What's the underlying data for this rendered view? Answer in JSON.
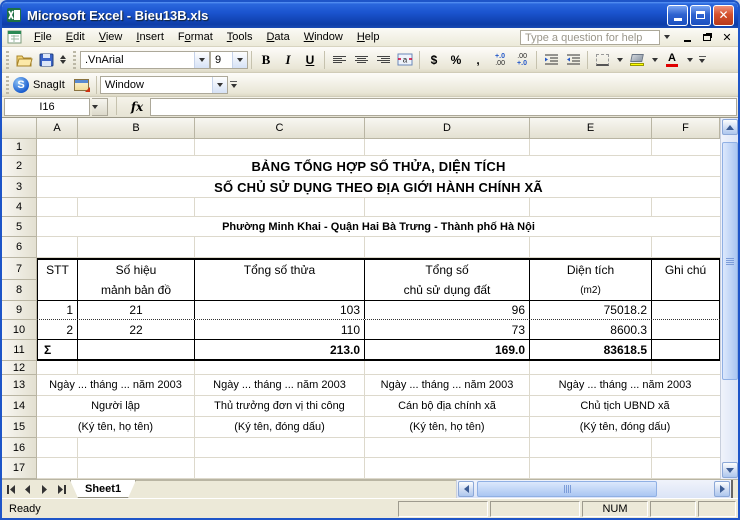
{
  "window": {
    "title": "Microsoft Excel - Bieu13B.xls"
  },
  "menu": {
    "items": [
      {
        "label": "File",
        "u": 0
      },
      {
        "label": "Edit",
        "u": 0
      },
      {
        "label": "View",
        "u": 0
      },
      {
        "label": "Insert",
        "u": 0
      },
      {
        "label": "Format",
        "u": 1
      },
      {
        "label": "Tools",
        "u": 0
      },
      {
        "label": "Data",
        "u": 0
      },
      {
        "label": "Window",
        "u": 0
      },
      {
        "label": "Help",
        "u": 0
      }
    ],
    "help_placeholder": "Type a question for help"
  },
  "toolbar": {
    "font_name": ".VnArial",
    "font_size": "9",
    "bold": "B",
    "italic": "I",
    "underline": "U",
    "currency": "$",
    "percent": "%",
    "comma": ",",
    "inc_decimal_top": "+.0",
    "inc_decimal_bot": ".00",
    "dec_decimal_top": ".00",
    "dec_decimal_bot": "+.0",
    "font_color_letter": "A"
  },
  "snagit": {
    "label": "SnagIt",
    "mode": "Window"
  },
  "formula_bar": {
    "name_box": "I16",
    "fx": "fx"
  },
  "grid": {
    "columns": [
      "A",
      "B",
      "C",
      "D",
      "E",
      "F"
    ],
    "rows": [
      "1",
      "2",
      "3",
      "4",
      "5",
      "6",
      "7",
      "8",
      "9",
      "10",
      "11",
      "12",
      "13",
      "14",
      "15",
      "16",
      "17"
    ]
  },
  "sheet": {
    "title_line1": "BẢNG TỔNG HỢP SỐ THỬA, DIỆN TÍCH",
    "title_line2": "SỐ CHỦ SỬ DỤNG THEO ĐỊA GIỚI HÀNH CHÍNH XÃ",
    "subtitle": "Phường Minh Khai  -  Quận Hai Bà Trưng  -  Thành phố Hà Nội",
    "table": {
      "header": {
        "stt": "STT",
        "map_sheet_1": "Số hiệu",
        "map_sheet_2": "mảnh bản đồ",
        "parcels": "Tổng số thửa",
        "owners_1": "Tổng số",
        "owners_2": "chủ sử dụng đất",
        "area_1": "Diện tích",
        "area_2": "(m2)",
        "notes": "Ghi chú"
      },
      "rows": [
        {
          "stt": "1",
          "map": "21",
          "parcels": "103",
          "owners": "96",
          "area": "75018.2"
        },
        {
          "stt": "2",
          "map": "22",
          "parcels": "110",
          "owners": "73",
          "area": "8600.3"
        }
      ],
      "total": {
        "symbol": "Σ",
        "parcels": "213.0",
        "owners": "169.0",
        "area": "83618.5"
      }
    },
    "signatures": {
      "dates": [
        "Ngày ... tháng ... năm 2003",
        "Ngày ... tháng  ... năm 2003",
        "Ngày ... tháng ... năm 2003",
        "Ngày ... tháng ... năm 2003"
      ],
      "roles": [
        "Người lập",
        "Thủ trưởng đơn vị thi công",
        "Cán bộ địa chính xã",
        "Chủ tịch UBND xã"
      ],
      "notes": [
        "(Ký tên, họ tên)",
        "(Ký tên, đóng dấu)",
        "(Ký tên, họ tên)",
        "(Ký tên, đóng dấu)"
      ]
    }
  },
  "tabs": {
    "sheet1": "Sheet1"
  },
  "status": {
    "ready": "Ready",
    "num": "NUM"
  },
  "colors": {
    "titlebar_blue": "#1b54cf",
    "close_red": "#d4502c",
    "fill_yellow": "#ffff00",
    "font_color_red": "#e00000",
    "table_border": "#000000",
    "gridline": "#ddd9cc"
  }
}
